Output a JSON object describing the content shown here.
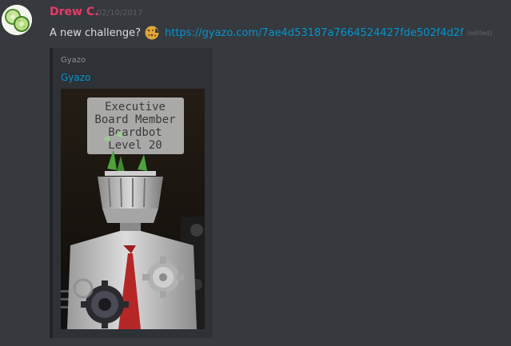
{
  "message": {
    "author": "Drew C.",
    "author_color": "#e73c66",
    "timestamp": "02/10/2017",
    "text": "A new challenge?",
    "emoji": "cookie-emoji",
    "link": "https://gyazo.com/7ae4d53187a7664524427fde502f4d2f",
    "edited": "(edited)",
    "avatar": "cucumber-slices-avatar"
  },
  "embed": {
    "provider": "Gyazo",
    "title": "Gyazo",
    "image_sign": {
      "line1": "Executive",
      "line2": "Board Member",
      "line3": "Boardbot",
      "line4": "Level 20"
    }
  },
  "colors": {
    "background": "#36393e",
    "embed_background": "#2e3136",
    "link": "#0096cf",
    "text": "#dcddde"
  }
}
